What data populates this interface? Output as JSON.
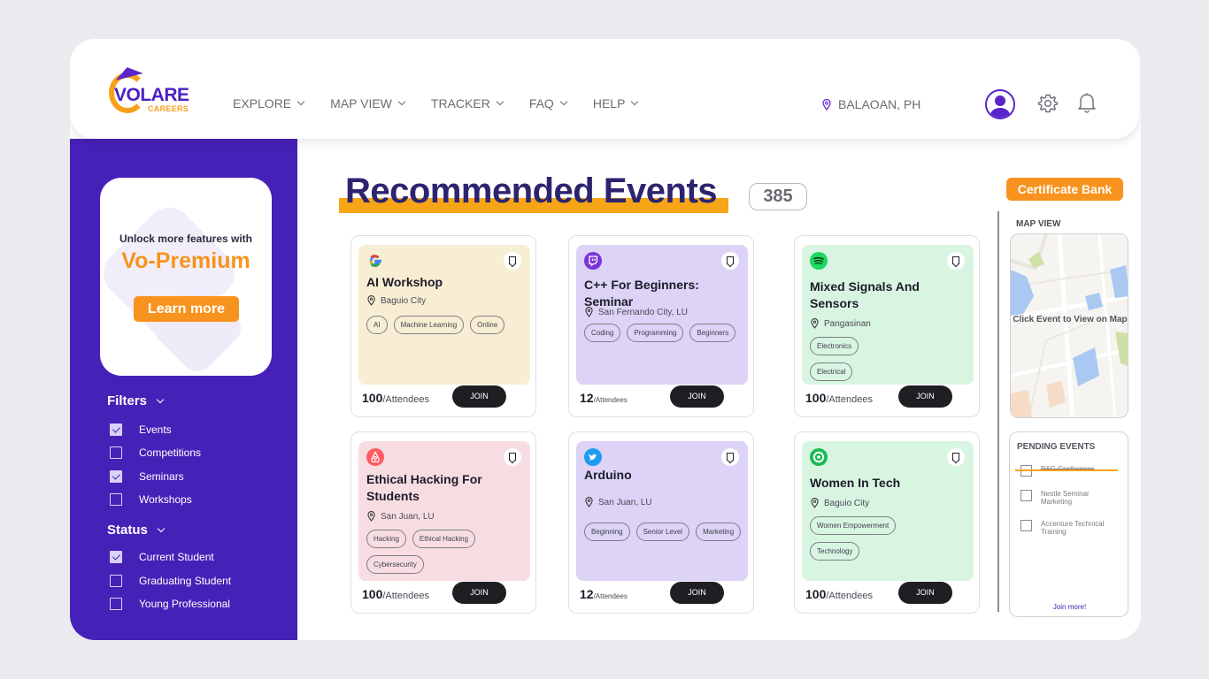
{
  "brand": {
    "name": "VOLARE",
    "sub": "CAREERS"
  },
  "nav": [
    {
      "label": "EXPLORE"
    },
    {
      "label": "MAP VIEW"
    },
    {
      "label": "TRACKER"
    },
    {
      "label": "FAQ"
    },
    {
      "label": "HELP"
    }
  ],
  "location": "BALAOAN, PH",
  "icons": {
    "profile": "user-icon",
    "settings": "gear-icon",
    "notifications": "bell-icon"
  },
  "promo": {
    "line1": "Unlock more features with",
    "line2": "Vo-Premium",
    "button": "Learn more"
  },
  "filters": {
    "title": "Filters",
    "items": [
      {
        "label": "Events",
        "checked": true
      },
      {
        "label": "Competitions",
        "checked": false
      },
      {
        "label": "Seminars",
        "checked": true
      },
      {
        "label": "Workshops",
        "checked": false
      }
    ]
  },
  "status": {
    "title": "Status",
    "items": [
      {
        "label": "Current Student",
        "checked": true
      },
      {
        "label": "Graduating Student",
        "checked": false
      },
      {
        "label": "Young Professional",
        "checked": false
      }
    ]
  },
  "main": {
    "title": "Recommended Events",
    "count": "385",
    "certificate_button": "Certificate Bank"
  },
  "events": [
    {
      "logo": "google-icon",
      "title": "AI Workshop",
      "location": "Baguio City",
      "tags": [
        "AI",
        "Machine Learning",
        "Online"
      ],
      "attendees": "100",
      "unit": "/Attendees",
      "join": "JOIN",
      "color": "#f8eed3"
    },
    {
      "logo": "twitch-icon",
      "title": "C++ For Beginners: Seminar",
      "location": "San Fernando City, LU",
      "tags": [
        "Coding",
        "Programming",
        "Beginners"
      ],
      "attendees": "12",
      "unit": "/Attendees",
      "join": "JOIN",
      "color": "#dcd3f6"
    },
    {
      "logo": "spotify-icon",
      "title": "Mixed Signals And Sensors",
      "location": "Pangasinan",
      "tags": [
        "Electronics",
        "Electrical"
      ],
      "attendees": "100",
      "unit": "/Attendees",
      "join": "JOIN",
      "color": "#d8f5e2"
    },
    {
      "logo": "airbnb-icon",
      "title": "Ethical Hacking For Students",
      "location": "San Juan, LU",
      "tags": [
        "Hacking",
        "Ethical Hacking",
        "Cybersecurity"
      ],
      "attendees": "100",
      "unit": "/Attendees",
      "join": "JOIN",
      "color": "#f7dde2"
    },
    {
      "logo": "twitter-icon",
      "title": "Arduino",
      "location": "San Juan, LU",
      "tags": [
        "Beginning",
        "Senior Level",
        "Marketing"
      ],
      "attendees": "12",
      "unit": "/Attendees",
      "join": "JOIN",
      "color": "#dcd3f6"
    },
    {
      "logo": "target-icon",
      "title": "Women In Tech",
      "location": "Baguio City",
      "tags": [
        "Women Empowerment",
        "Technology"
      ],
      "attendees": "100",
      "unit": "/Attendees",
      "join": "JOIN",
      "color": "#d8f5e2"
    }
  ],
  "map": {
    "label": "MAP VIEW",
    "hint": "Click Event to View on Map"
  },
  "pending": {
    "title": "PENDING EVENTS",
    "items": [
      {
        "label": "P&G Conference",
        "done": true
      },
      {
        "label": "Nestle Seminar Marketing",
        "done": false
      },
      {
        "label": "Accenture Technical Training",
        "done": false
      }
    ],
    "more": "Join more!"
  },
  "colors": {
    "primary": "#4621b8",
    "accent": "#f7931e",
    "title": "#2d2470"
  }
}
